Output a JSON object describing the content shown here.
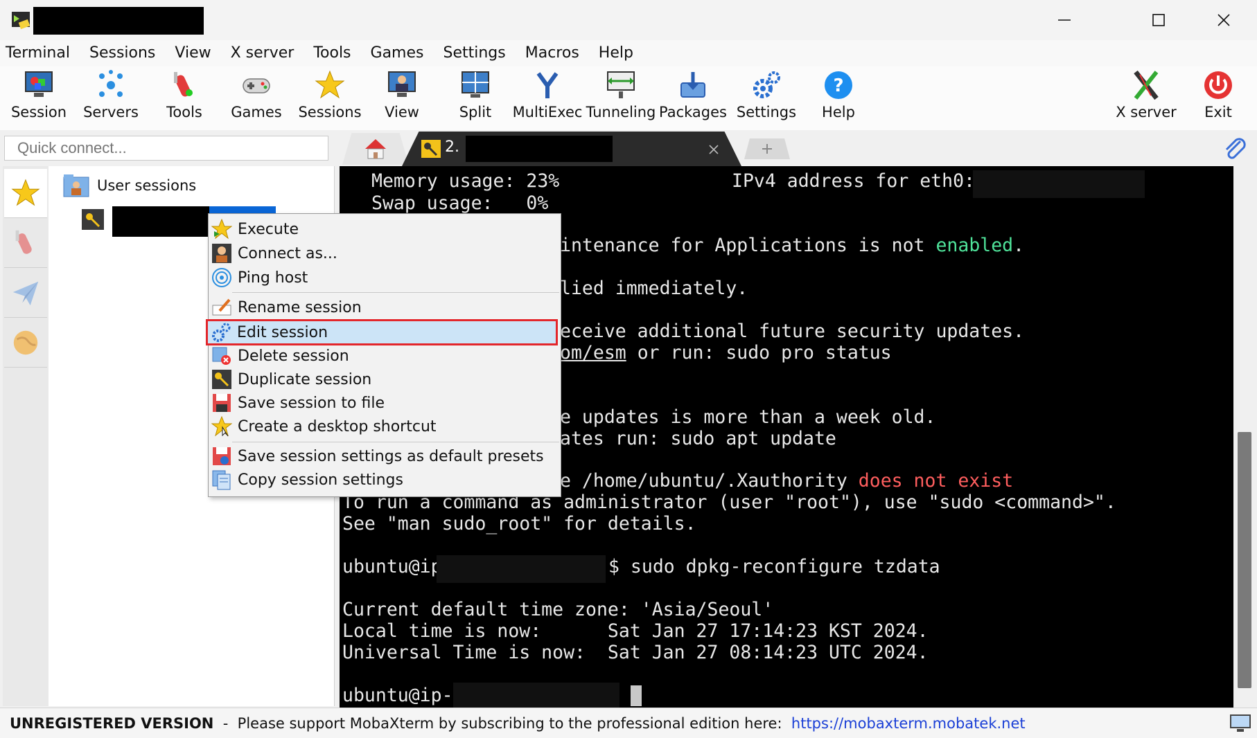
{
  "menu": [
    "Terminal",
    "Sessions",
    "View",
    "X server",
    "Tools",
    "Games",
    "Settings",
    "Macros",
    "Help"
  ],
  "toolbar": {
    "session": "Session",
    "servers": "Servers",
    "tools": "Tools",
    "games": "Games",
    "sessions": "Sessions",
    "view": "View",
    "split": "Split",
    "multiexec": "MultiExec",
    "tunneling": "Tunneling",
    "packages": "Packages",
    "settings": "Settings",
    "help": "Help",
    "xserver": "X server",
    "exit": "Exit"
  },
  "quick_connect": {
    "placeholder": "Quick connect..."
  },
  "tabs": {
    "session_tab_label": "2."
  },
  "tree": {
    "root": "User sessions"
  },
  "terminal": {
    "l1a": "Memory usage: 23%",
    "l1b": "IPv4 address for eth0:",
    "l2": "Swap usage:   0%",
    "l3a": "intenance for Applications is not ",
    "l3b": "enabled",
    "l3c": ".",
    "l4": "lied immediately.",
    "l5": "eceive additional future security updates.",
    "l6a": "om/esm",
    "l6b": " or run: sudo pro status",
    "l7": "e updates is more than a week old.",
    "l8": "ates run: sudo apt update",
    "l9a": "e /home/ubuntu/.Xauthority ",
    "l9b": "does not exist",
    "l10": "To run a command as administrator (user \"root\"), use \"sudo <command>\".",
    "l11": "See \"man sudo_root\" for details.",
    "l12a": "ubuntu@ip",
    "l12b": "$ sudo dpkg-reconfigure tzdata",
    "l13": "Current default time zone: 'Asia/Seoul'",
    "l14": "Local time is now:      Sat Jan 27 17:14:23 KST 2024.",
    "l15": "Universal Time is now:  Sat Jan 27 08:14:23 UTC 2024.",
    "l16": "ubuntu@ip-"
  },
  "context_menu": {
    "execute": "Execute",
    "connect_as": "Connect as...",
    "ping": "Ping host",
    "rename": "Rename session",
    "edit": "Edit session",
    "delete": "Delete session",
    "duplicate": "Duplicate session",
    "save_file": "Save session to file",
    "shortcut": "Create a desktop shortcut",
    "save_presets": "Save session settings as default presets",
    "copy_settings": "Copy session settings"
  },
  "status": {
    "unregistered": "UNREGISTERED VERSION",
    "sep": "  -  ",
    "message": "Please support MobaXterm by subscribing to the professional edition here:  ",
    "link": "https://mobaxterm.mobatek.net"
  },
  "colors": {
    "accent_green": "#4fe39a",
    "error_red": "#ff5e5e",
    "highlight_border": "#e3262b",
    "link_blue": "#1a3fd6"
  }
}
